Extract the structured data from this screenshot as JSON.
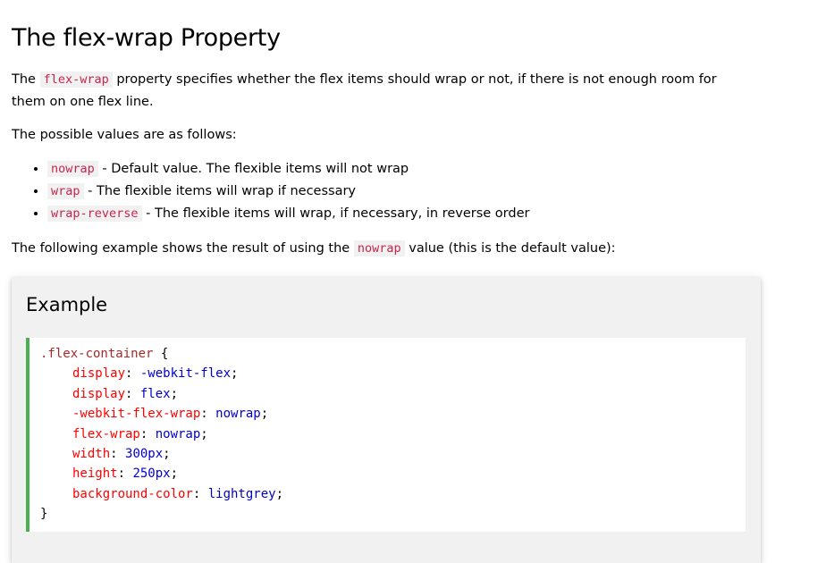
{
  "page": {
    "title": "The flex-wrap Property",
    "intro": {
      "prefix": "The ",
      "code": "flex-wrap",
      "suffix": " property specifies whether the flex items should wrap or not, if there is not enough room for them on one flex line."
    },
    "possible_values_text": "The possible values are as follows:",
    "values": [
      {
        "code": "nowrap",
        "desc": " - Default value. The flexible items will not wrap"
      },
      {
        "code": "wrap",
        "desc": " - The flexible items will wrap if necessary"
      },
      {
        "code": "wrap-reverse",
        "desc": " - The flexible items will wrap, if necessary, in reverse order"
      }
    ],
    "following": {
      "prefix": "The following example shows the result of using the ",
      "code": "nowrap",
      "suffix": " value (this is the default value):"
    }
  },
  "example": {
    "heading": "Example",
    "selector": ".flex-container",
    "open_brace": " {",
    "close_brace": "}",
    "declarations": [
      {
        "prop": "display",
        "value": "-webkit-flex"
      },
      {
        "prop": "display",
        "value": "flex"
      },
      {
        "prop": "-webkit-flex-wrap",
        "value": "nowrap"
      },
      {
        "prop": "flex-wrap",
        "value": "nowrap"
      },
      {
        "prop": "width",
        "value": "300px"
      },
      {
        "prop": "height",
        "value": "250px"
      },
      {
        "prop": "background-color",
        "value": "lightgrey"
      }
    ]
  },
  "colors": {
    "inline_code_text": "#c7254e",
    "inline_code_bg": "#f1f1f1",
    "example_bg": "#f1f1f1",
    "code_border": "#4CAF50",
    "css_selector": "#a52a2a",
    "css_property": "#ff0000",
    "css_value": "#0000cd"
  }
}
